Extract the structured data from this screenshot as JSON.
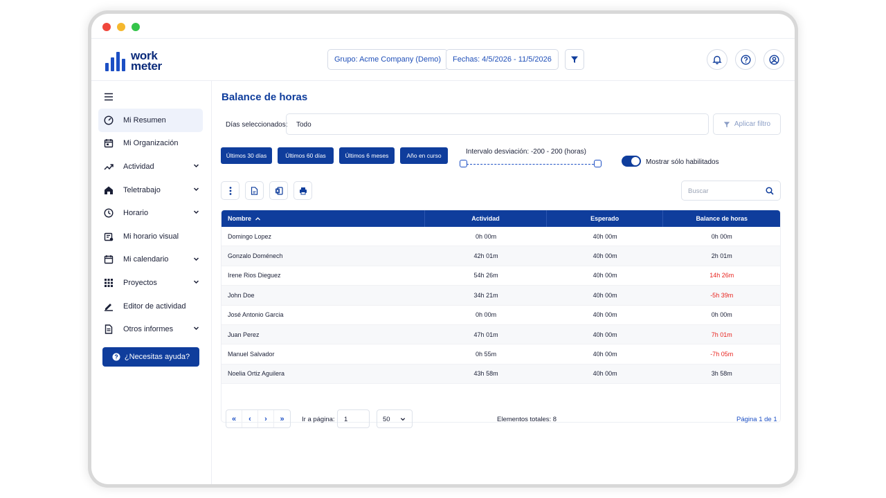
{
  "brand": {
    "line1": "work",
    "line2": "meter"
  },
  "topbar": {
    "group": "Grupo: Acme Company (Demo)",
    "dates": "Fechas: 4/5/2026 - 11/5/2026"
  },
  "sidebar": {
    "items": [
      {
        "label": "Mi Resumen",
        "icon": "gauge-icon",
        "active": true,
        "expandable": false
      },
      {
        "label": "Mi Organización",
        "icon": "calendar-check-icon",
        "expandable": false
      },
      {
        "label": "Actividad",
        "icon": "trend-icon",
        "expandable": true
      },
      {
        "label": "Teletrabajo",
        "icon": "home-icon",
        "expandable": true
      },
      {
        "label": "Horario",
        "icon": "clock-icon",
        "expandable": true
      },
      {
        "label": "Mi horario visual",
        "icon": "schedule-icon",
        "expandable": false
      },
      {
        "label": "Mi calendario",
        "icon": "calendar-icon",
        "expandable": true
      },
      {
        "label": "Proyectos",
        "icon": "grid-icon",
        "expandable": true
      },
      {
        "label": "Editor de actividad",
        "icon": "pencil-icon",
        "expandable": false
      },
      {
        "label": "Otros informes",
        "icon": "report-icon",
        "expandable": true
      }
    ],
    "help": "¿Necesitas ayuda?"
  },
  "main": {
    "title": "Balance de horas",
    "days_label": "Días seleccionados:",
    "days_value": "Todo",
    "apply_filter": "Aplicar filtro",
    "ranges": [
      "Últimos 30 días",
      "Últimos 60 días",
      "Últimos 6 meses",
      "Año en curso"
    ],
    "interval": "Intervalo desviación: -200 - 200 (horas)",
    "toggle_label": "Mostrar sólo habilitados",
    "toggle_on": true,
    "search_placeholder": "Buscar"
  },
  "table": {
    "headers": [
      "Nombre",
      "Actividad",
      "Esperado",
      "Balance de horas"
    ],
    "rows": [
      {
        "name": "Domingo Lopez",
        "activity": "0h 00m",
        "expected": "40h 00m",
        "balance": "0h 00m",
        "highlight": false
      },
      {
        "name": "Gonzalo Doménech",
        "activity": "42h 01m",
        "expected": "40h 00m",
        "balance": "2h 01m",
        "highlight": false
      },
      {
        "name": "Irene Rios Dieguez",
        "activity": "54h 26m",
        "expected": "40h 00m",
        "balance": "14h 26m",
        "highlight": true
      },
      {
        "name": "John Doe",
        "activity": "34h 21m",
        "expected": "40h 00m",
        "balance": "-5h 39m",
        "highlight": true
      },
      {
        "name": "José Antonio Garcia",
        "activity": "0h 00m",
        "expected": "40h 00m",
        "balance": "0h 00m",
        "highlight": false
      },
      {
        "name": "Juan Perez",
        "activity": "47h 01m",
        "expected": "40h 00m",
        "balance": "7h 01m",
        "highlight": true
      },
      {
        "name": "Manuel Salvador",
        "activity": "0h 55m",
        "expected": "40h 00m",
        "balance": "-7h 05m",
        "highlight": true
      },
      {
        "name": "Noelia Ortiz Aguilera",
        "activity": "43h 58m",
        "expected": "40h 00m",
        "balance": "3h 58m",
        "highlight": false
      }
    ]
  },
  "pagination": {
    "goto_label": "Ir a página:",
    "page": "1",
    "page_size": "50",
    "total": "Elementos totales: 8",
    "page_info": "Página 1 de 1"
  },
  "colors": {
    "primary": "#0f3d9c",
    "accent": "#1c4fc4",
    "negative": "#e8231e"
  }
}
